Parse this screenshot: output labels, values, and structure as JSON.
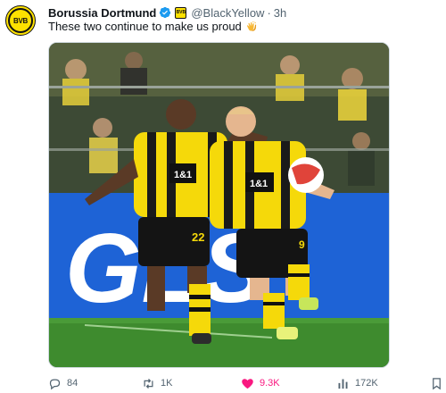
{
  "tweet": {
    "author_name": "Borussia Dortmund",
    "avatar_text": "BVB",
    "handle": "@BlackYellow",
    "separator": "·",
    "time": "3h",
    "text": "These two continue to make us proud",
    "emoji": "clapping-hands"
  },
  "media": {
    "ad_board_text": "GLS",
    "player_left_number": "22",
    "player_right_number": "9",
    "sponsor": "1&1"
  },
  "actions": {
    "replies": "84",
    "retweets": "1K",
    "likes": "9.3K",
    "views": "172K"
  },
  "colors": {
    "bvb_yellow": "#fde100",
    "like_pink": "#f91880",
    "muted": "#536471",
    "verified_blue": "#1d9bf0"
  }
}
